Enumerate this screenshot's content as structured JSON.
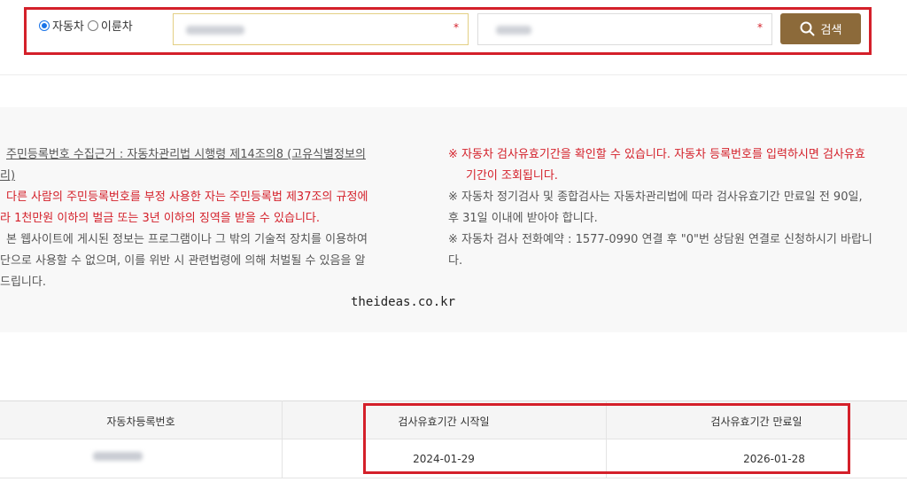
{
  "search": {
    "vehicle_types": [
      "자동차",
      "이륜차"
    ],
    "selected_type": "자동차",
    "field1_required_mark": "*",
    "field2_required_mark": "*",
    "button_label": "검색"
  },
  "info": {
    "left_lines": [
      "주민등록번호 수집근거 : 자동차관리법 시행령 제14조의8 (고유식별정보의",
      "리)",
      "다른 사람의 주민등록번호를 부정 사용한 자는 주민등록법 제37조의 규정에",
      "라 1천만원 이하의 벌금 또는 3년 이하의 징역을 받을 수 있습니다.",
      "본 웹사이트에 게시된 정보는 프로그램이나 그 밖의 기술적 장치를 이용하여",
      "단으로 사용할 수 없으며, 이를 위반 시 관련법령에 의해 처벌될 수 있음을 알",
      "드립니다."
    ],
    "right_lines": [
      "※ 자동차 검사유효기간을 확인할 수 있습니다. 자동차 등록번호를 입력하시면 검사유효",
      "기간이 조회됩니다.",
      "※ 자동차 정기검사 및 종합검사는 자동차관리법에 따라 검사유효기간 만료일 전 90일,",
      "후 31일 이내에 받아야 합니다.",
      "※ 자동차 검사 전화예약 : 1577-0990 연결 후 \"0\"번 상담원 연결로 신청하시기 바랍니",
      "다."
    ]
  },
  "watermark": "theideas.co.kr",
  "table": {
    "headers": [
      "자동차등록번호",
      "검사유효기간 시작일",
      "검사유효기간 만료일"
    ],
    "row": [
      "",
      "2024-01-29",
      "2026-01-28"
    ]
  },
  "colors": {
    "accent_red": "#d4202a",
    "brand_brown": "#8c6a3a",
    "radio_blue": "#1a73e8"
  }
}
